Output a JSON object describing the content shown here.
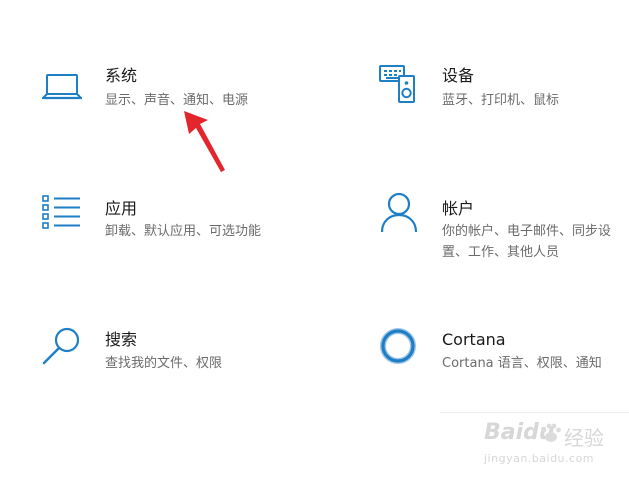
{
  "settings": {
    "tiles": [
      {
        "title": "系统",
        "desc_lines": [
          "显示、声音、通知、电源"
        ],
        "icon": "laptop-icon"
      },
      {
        "title": "设备",
        "desc_lines": [
          "蓝牙、打印机、鼠标"
        ],
        "icon": "devices-icon"
      },
      {
        "title": "应用",
        "desc_lines": [
          "卸载、默认应用、可选功能"
        ],
        "icon": "apps-list-icon"
      },
      {
        "title": "帐户",
        "desc_lines": [
          "你的帐户、电子邮件、同步设",
          "置、工作、其他人员"
        ],
        "icon": "person-icon"
      },
      {
        "title": "搜索",
        "desc_lines": [
          "查找我的文件、权限"
        ],
        "icon": "search-icon"
      },
      {
        "title": "Cortana",
        "desc_lines": [
          "Cortana 语言、权限、通知"
        ],
        "icon": "cortana-icon"
      }
    ]
  },
  "annotation": {
    "icon": "red-arrow-icon",
    "color": "#e3262b"
  },
  "watermark": {
    "logo_text": "Baidu",
    "brand_text": "经验",
    "url": "jingyan.baidu.com"
  },
  "colors": {
    "accent": "#1e7fc4",
    "title": "#1a1a1a",
    "desc": "#6b6b6b"
  }
}
